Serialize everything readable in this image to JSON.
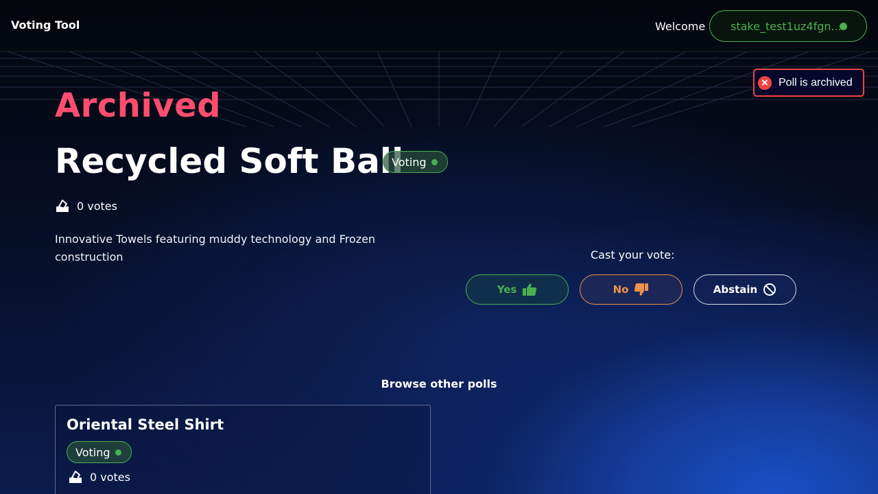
{
  "header": {
    "brand": "Voting Tool",
    "welcome": "Welcome",
    "wallet_address": "stake_test1uz4fgn...",
    "wallet_status_color": "#4caf50"
  },
  "toast": {
    "message": "Poll is archived",
    "icon": "error-x-icon",
    "color": "#f04444"
  },
  "poll": {
    "state_heading": "Archived",
    "title": "Recycled Soft Ball",
    "status": "Voting",
    "votes": "0 votes",
    "description": "Innovative Towels featuring muddy technology and Frozen construction"
  },
  "vote": {
    "label": "Cast your vote:",
    "yes": "Yes",
    "no": "No",
    "abstain": "Abstain"
  },
  "browse": {
    "heading": "Browse other polls",
    "polls": [
      {
        "title": "Oriental Steel Shirt",
        "status": "Voting",
        "votes": "0 votes"
      }
    ]
  },
  "colors": {
    "archived": "#ff4d6d",
    "yes": "#4caf50",
    "no": "#f0934e",
    "accent_blue": "#1a4fc4"
  }
}
